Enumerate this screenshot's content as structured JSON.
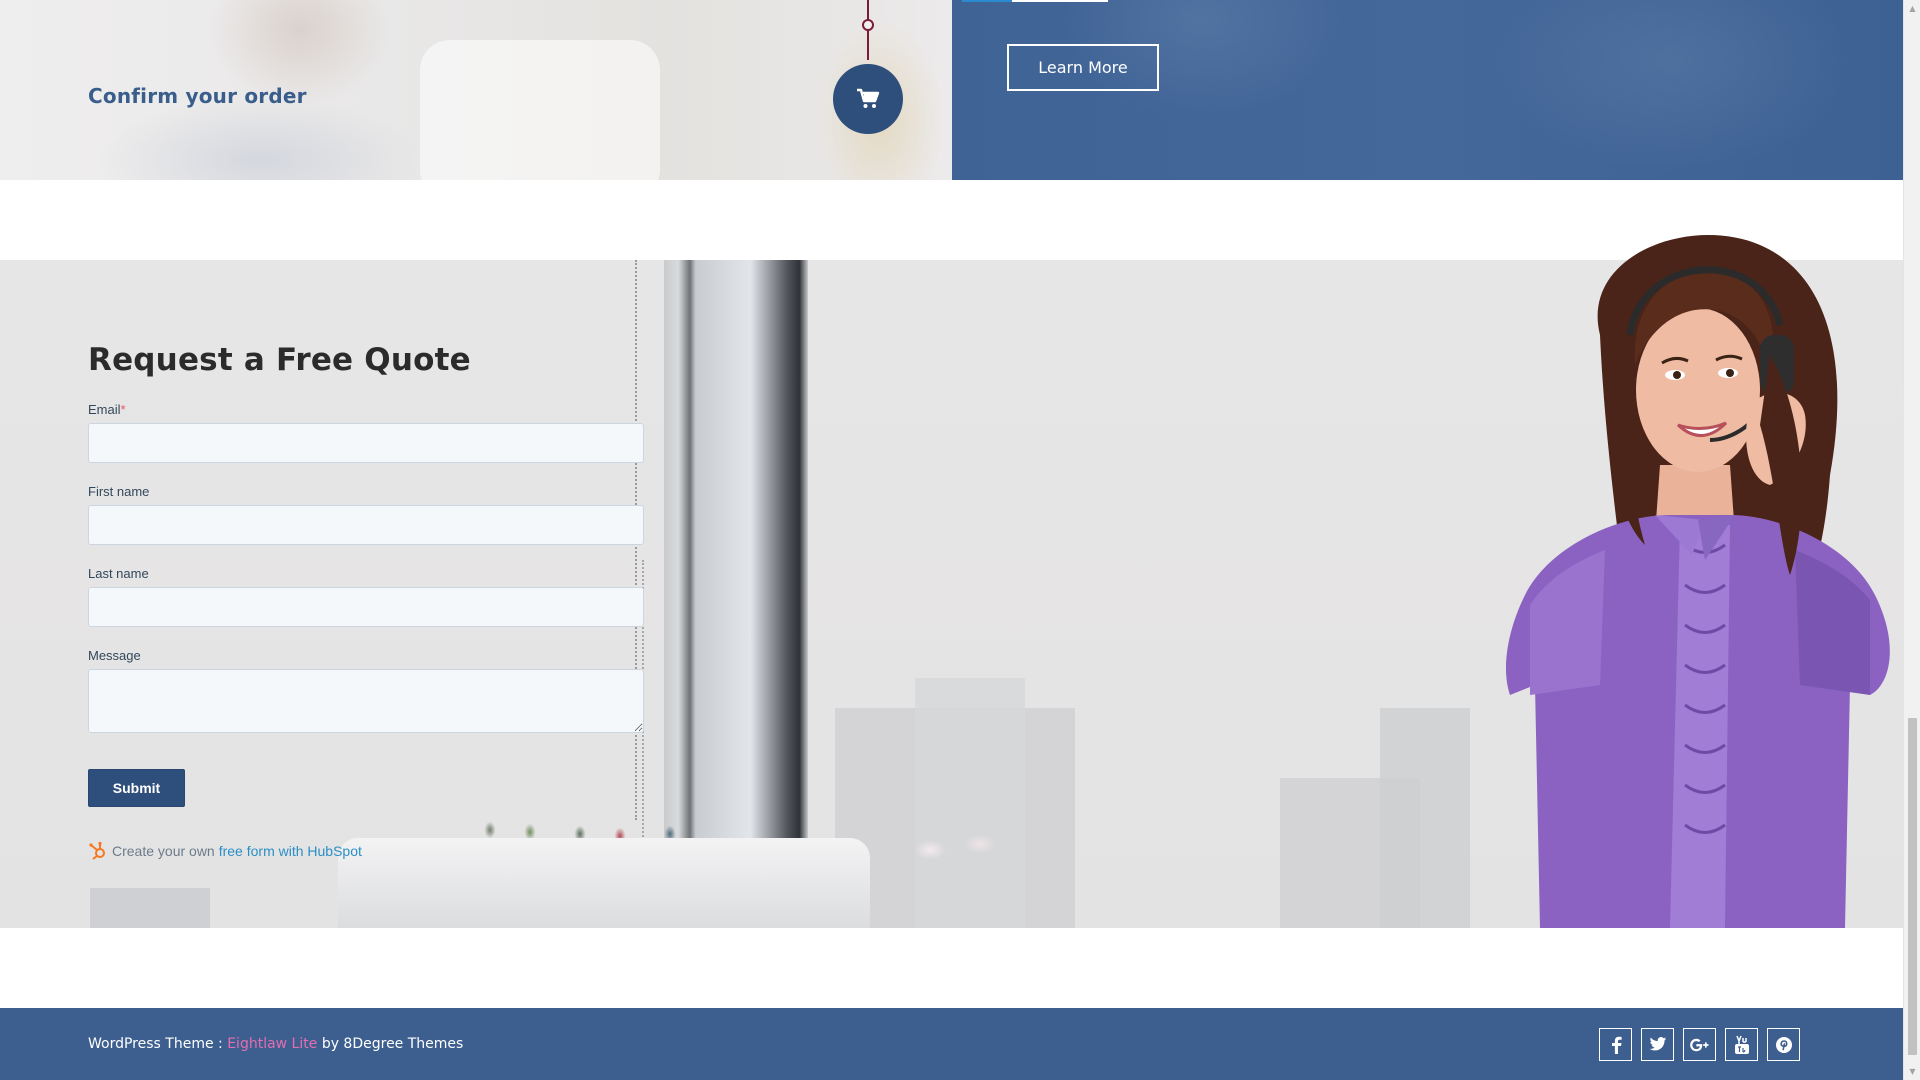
{
  "process": {
    "step_title": "Confirm your order",
    "step_icon": "shopping-cart-icon",
    "learn_more_label": "Learn More"
  },
  "quote_form": {
    "title": "Request a Free Quote",
    "email_label": "Email",
    "required_mark": "*",
    "email_value": "",
    "first_name_label": "First name",
    "first_name_value": "",
    "last_name_label": "Last name",
    "last_name_value": "",
    "message_label": "Message",
    "message_value": "",
    "submit_label": "Submit",
    "hubspot_prefix": "Create your own",
    "hubspot_link": "free form with HubSpot"
  },
  "footer": {
    "credit_prefix": "WordPress Theme :",
    "theme_name": "Eightlaw Lite",
    "credit_by": "by 8Degree Themes",
    "social": [
      "facebook-icon",
      "twitter-icon",
      "google-plus-icon",
      "youtube-icon",
      "pinterest-icon"
    ]
  },
  "colors": {
    "brand_blue": "#2e4f7c",
    "footer_blue": "#3d5f8f",
    "link_pink": "#e56db1",
    "timeline_maroon": "#7a1b3b"
  }
}
